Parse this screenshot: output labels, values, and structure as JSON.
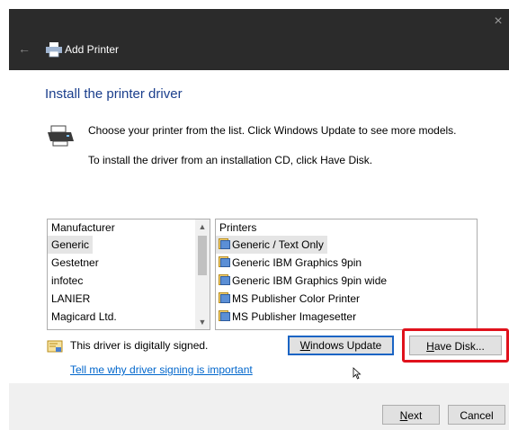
{
  "window": {
    "title": "Add Printer",
    "close_glyph": "×",
    "back_glyph": "←"
  },
  "heading": "Install the printer driver",
  "instructions": {
    "line1": "Choose your printer from the list. Click Windows Update to see more models.",
    "line2": "To install the driver from an installation CD, click Have Disk."
  },
  "manufacturer_list": {
    "header": "Manufacturer",
    "items": [
      "Generic",
      "Gestetner",
      "infotec",
      "LANIER",
      "Magicard Ltd."
    ],
    "selected": "Generic"
  },
  "printer_list": {
    "header": "Printers",
    "items": [
      "Generic / Text Only",
      "Generic IBM Graphics 9pin",
      "Generic IBM Graphics 9pin wide",
      "MS Publisher Color Printer",
      "MS Publisher Imagesetter"
    ],
    "selected": "Generic / Text Only"
  },
  "signing": {
    "status_text": "This driver is digitally signed.",
    "link_text": "Tell me why driver signing is important"
  },
  "buttons": {
    "windows_update": {
      "mnemonic": "W",
      "rest": "indows Update"
    },
    "have_disk": {
      "mnemonic": "H",
      "rest": "ave Disk..."
    },
    "next": {
      "mnemonic": "N",
      "rest": "ext"
    },
    "cancel": "Cancel"
  },
  "colors": {
    "titlebar": "#2b2b2b",
    "heading": "#1a3e8c",
    "link": "#0066cc",
    "highlight": "#e0121c",
    "default_button_border": "#1a64c4"
  },
  "icons": {
    "printer": "printer-icon",
    "signed": "certificate-icon",
    "driver": "driver-file-icon"
  }
}
